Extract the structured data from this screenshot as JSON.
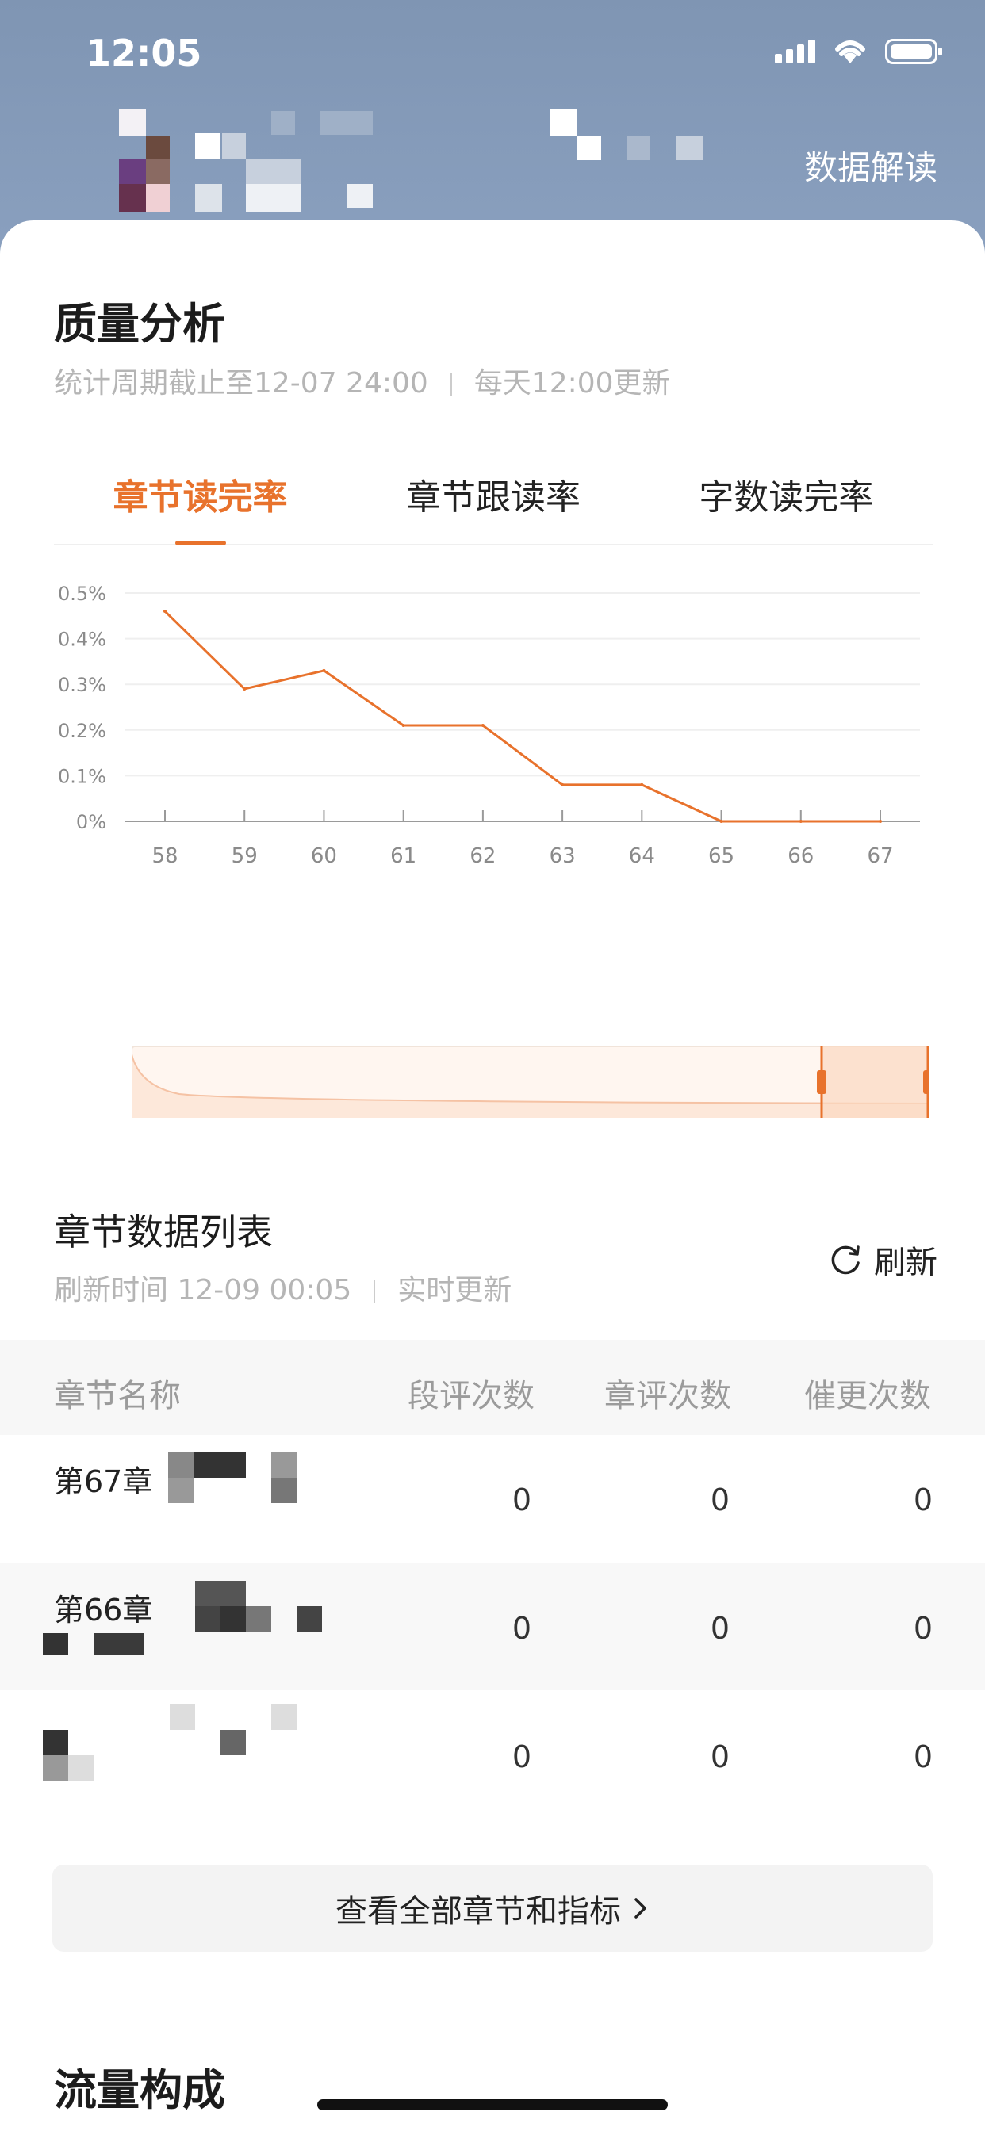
{
  "status_bar": {
    "time": "12:05"
  },
  "header": {
    "right_action": "数据解读"
  },
  "quality": {
    "title": "质量分析",
    "period": "统计周期截止至12-07 24:00",
    "update": "每天12:00更新",
    "tabs": [
      "章节读完率",
      "章节跟读率",
      "字数读完率"
    ],
    "active_tab": 0
  },
  "chart_data": {
    "type": "line",
    "x": [
      "58",
      "59",
      "60",
      "61",
      "62",
      "63",
      "64",
      "65",
      "66",
      "67"
    ],
    "series": [
      {
        "values": [
          0.46,
          0.29,
          0.33,
          0.21,
          0.21,
          0.08,
          0.08,
          0,
          0,
          0
        ]
      }
    ],
    "y_ticks": [
      "0%",
      "0.1%",
      "0.2%",
      "0.3%",
      "0.4%",
      "0.5%"
    ],
    "ylim": [
      0,
      0.5
    ],
    "grid": true,
    "line_color": "#e8722c"
  },
  "chapter_list": {
    "title": "章节数据列表",
    "refresh_time": "刷新时间 12-09 00:05",
    "realtime": "实时更新",
    "refresh_label": "刷新",
    "columns": [
      "章节名称",
      "段评次数",
      "章评次数",
      "催更次数"
    ],
    "rows": [
      {
        "name": "第67章",
        "c1": "0",
        "c2": "0",
        "c3": "0"
      },
      {
        "name": "第66章",
        "c1": "0",
        "c2": "0",
        "c3": "0"
      },
      {
        "name": "",
        "c1": "0",
        "c2": "0",
        "c3": "0"
      }
    ],
    "view_all": "查看全部章节和指标"
  },
  "traffic": {
    "title": "流量构成"
  },
  "colors": {
    "accent": "#e8722c",
    "header_bg": "#8aa0bf"
  }
}
